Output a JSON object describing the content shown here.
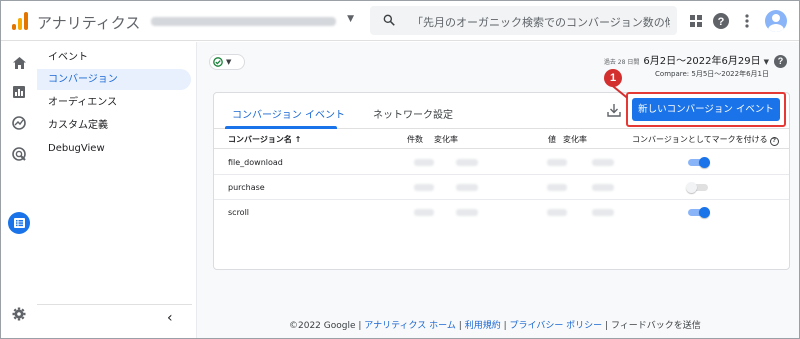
{
  "header": {
    "brand": "アナリティクス",
    "search_placeholder": "「先月のオーガニック検索でのコンバージョン数の傾向…"
  },
  "nav": {
    "items": [
      {
        "label": "イベント",
        "active": false
      },
      {
        "label": "コンバージョン",
        "active": true
      },
      {
        "label": "オーディエンス",
        "active": false
      },
      {
        "label": "カスタム定義",
        "active": false
      },
      {
        "label": "DebugView",
        "active": false
      }
    ]
  },
  "daterange": {
    "prefix": "過去 28 日間",
    "range": "6月2日～2022年6月29日",
    "compare": "Compare: 5月5日～2022年6月1日"
  },
  "card": {
    "tabs": [
      "コンバージョン イベント",
      "ネットワーク設定"
    ],
    "new_button": "新しいコンバージョン イベント",
    "callout_number": "1",
    "columns": {
      "name": "コンバージョン名 ↑",
      "count": "件数",
      "count_change": "変化率",
      "value": "値",
      "value_change": "変化率",
      "mark": "コンバージョンとしてマークを付ける",
      "help": "?"
    },
    "rows": [
      {
        "name": "file_download",
        "marked": true
      },
      {
        "name": "purchase",
        "marked": false
      },
      {
        "name": "scroll",
        "marked": true
      }
    ]
  },
  "footer": {
    "copyright": "©2022 Google |",
    "link1": "アナリティクス ホーム",
    "sep1": "|",
    "link2": "利用規約",
    "sep2": "|",
    "link3": "プライバシー ポリシー",
    "sep3": "|",
    "feedback": "フィードバックを送信"
  },
  "colors": {
    "accent": "#1a73e8",
    "highlight": "#e53935"
  }
}
